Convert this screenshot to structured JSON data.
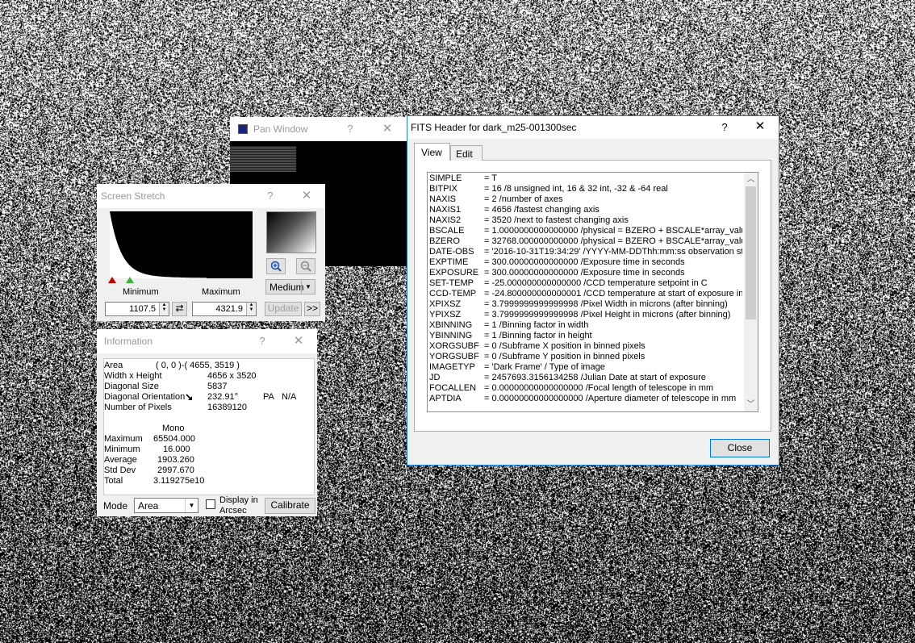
{
  "pan_window": {
    "title": "Pan Window",
    "help": "?",
    "close": "✕"
  },
  "screen_stretch": {
    "title": "Screen Stretch",
    "help": "?",
    "close": "✕",
    "minimum_label": "Minimum",
    "maximum_label": "Maximum",
    "minimum_value": "1107.5",
    "maximum_value": "4321.9",
    "preset": "Medium",
    "update_label": "Update",
    "more_label": ">>",
    "swap_icon": "⇄"
  },
  "information": {
    "title": "Information",
    "help": "?",
    "close": "✕",
    "rows": [
      {
        "key": "Area",
        "value": "( 0, 0 )-( 4655, 3519 )"
      },
      {
        "key": "Width x Height",
        "value": "4656 x 3520"
      },
      {
        "key": "Diagonal Size",
        "value": "5837"
      },
      {
        "key": "Diagonal Orientation",
        "value": "232.91°"
      },
      {
        "key": "Number of Pixels",
        "value": "16389120"
      }
    ],
    "pa_label": "PA",
    "pa_value": "N/A",
    "stats_header": "Mono",
    "stats": [
      {
        "key": "Maximum",
        "value": "65504.000"
      },
      {
        "key": "Minimum",
        "value": "16.000"
      },
      {
        "key": "Average",
        "value": "1903.260"
      },
      {
        "key": "Std Dev",
        "value": "2997.670"
      },
      {
        "key": "Total",
        "value": "3.119275e10"
      }
    ],
    "mode_label": "Mode",
    "mode_value": "Area",
    "display_arcsec_line1": "Display in",
    "display_arcsec_line2": "Arcsec",
    "calibrate_label": "Calibrate >>"
  },
  "fits_header": {
    "title": "FITS Header for dark_m25-001300sec",
    "help": "?",
    "close": "✕",
    "tabs": [
      {
        "label": "View"
      },
      {
        "label": "Edit"
      }
    ],
    "entries": [
      {
        "key": "SIMPLE",
        "value": "= T"
      },
      {
        "key": "BITPIX",
        "value": "= 16 /8 unsigned int, 16 & 32 int, -32 & -64 real"
      },
      {
        "key": "NAXIS",
        "value": "= 2 /number of axes"
      },
      {
        "key": "NAXIS1",
        "value": "= 4656 /fastest changing axis"
      },
      {
        "key": "NAXIS2",
        "value": "= 3520 /next to fastest changing axis"
      },
      {
        "key": "BSCALE",
        "value": "= 1.0000000000000000 /physical = BZERO + BSCALE*array_value"
      },
      {
        "key": "BZERO",
        "value": "= 32768.000000000000 /physical = BZERO + BSCALE*array_value"
      },
      {
        "key": "DATE-OBS",
        "value": "= '2016-10-31T19:34:29' /YYYY-MM-DDThh:mm:ss observation start"
      },
      {
        "key": "EXPTIME",
        "value": "= 300.00000000000000 /Exposure time in seconds"
      },
      {
        "key": "EXPOSURE",
        "value": "= 300.00000000000000 /Exposure time in seconds"
      },
      {
        "key": "SET-TEMP",
        "value": "= -25.000000000000000 /CCD temperature setpoint in C"
      },
      {
        "key": "CCD-TEMP",
        "value": "= -24.800000000000001 /CCD temperature at start of exposure in C"
      },
      {
        "key": "XPIXSZ",
        "value": "= 3.7999999999999998 /Pixel Width in microns (after binning)"
      },
      {
        "key": "YPIXSZ",
        "value": "= 3.7999999999999998 /Pixel Height in microns (after binning)"
      },
      {
        "key": "XBINNING",
        "value": "= 1 /Binning factor in width"
      },
      {
        "key": "YBINNING",
        "value": "= 1 /Binning factor in height"
      },
      {
        "key": "XORGSUBF",
        "value": "= 0 /Subframe X position in binned pixels"
      },
      {
        "key": "YORGSUBF",
        "value": "= 0 /Subframe Y position in binned pixels"
      },
      {
        "key": "IMAGETYP",
        "value": "= 'Dark Frame' /        Type of image"
      },
      {
        "key": "JD",
        "value": "= 2457693.3156134258 /Julian Date at start of exposure"
      },
      {
        "key": "FOCALLEN",
        "value": "= 0.00000000000000000 /Focal length of telescope in mm"
      },
      {
        "key": "APTDIA",
        "value": "= 0.00000000000000000 /Aperture diameter of telescope in mm"
      }
    ],
    "close_button": "Close"
  }
}
